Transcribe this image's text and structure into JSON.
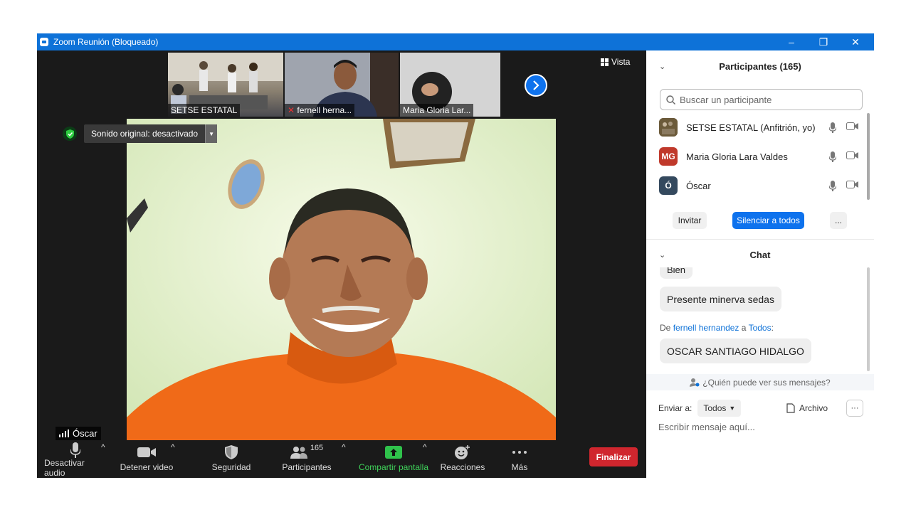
{
  "window": {
    "title": "Zoom Reunión (Bloqueado)",
    "controls": [
      "–",
      "❐",
      "✕"
    ]
  },
  "thumbnails": [
    {
      "label": "SETSE ESTATAL"
    },
    {
      "label": "fernell herna..."
    },
    {
      "label": "Maria Gloria Lar..."
    }
  ],
  "view": {
    "label": "Vista"
  },
  "audio_notice": {
    "label": "Sonido original: desactivado"
  },
  "speaker": {
    "name": "Óscar"
  },
  "toolbar": {
    "mute": "Desactivar audio",
    "video": "Detener video",
    "security": "Seguridad",
    "participants": "Participantes",
    "participants_count": "165",
    "share": "Compartir pantalla",
    "reactions": "Reacciones",
    "more": "Más",
    "end": "Finalizar"
  },
  "participants_panel": {
    "title": "Participantes (165)",
    "search_placeholder": "Buscar un participante",
    "people": [
      {
        "name": "SETSE ESTATAL (Anfitrión, yo)",
        "initials": "",
        "color": "#6b5a3a"
      },
      {
        "name": "Maria Gloria Lara Valdes",
        "initials": "MG",
        "color": "#c0392b"
      },
      {
        "name": "Óscar",
        "initials": "Ó",
        "color": "#34495e"
      }
    ],
    "invite": "Invitar",
    "mute_all": "Silenciar a todos",
    "more": "..."
  },
  "chat": {
    "title": "Chat",
    "partial_msg": "Bien",
    "msg1": "Presente minerva sedas",
    "from_prefix": "De",
    "from_name": "fernell hernandez",
    "to_prefix": "a",
    "to_name": "Todos",
    "to_suffix": ":",
    "msg2": "OSCAR SANTIAGO HIDALGO",
    "who_can_see": "¿Quién puede ver sus mensajes?",
    "send_to_label": "Enviar a:",
    "send_to_value": "Todos",
    "file": "Archivo",
    "input_placeholder": "Escribir mensaje aquí..."
  }
}
